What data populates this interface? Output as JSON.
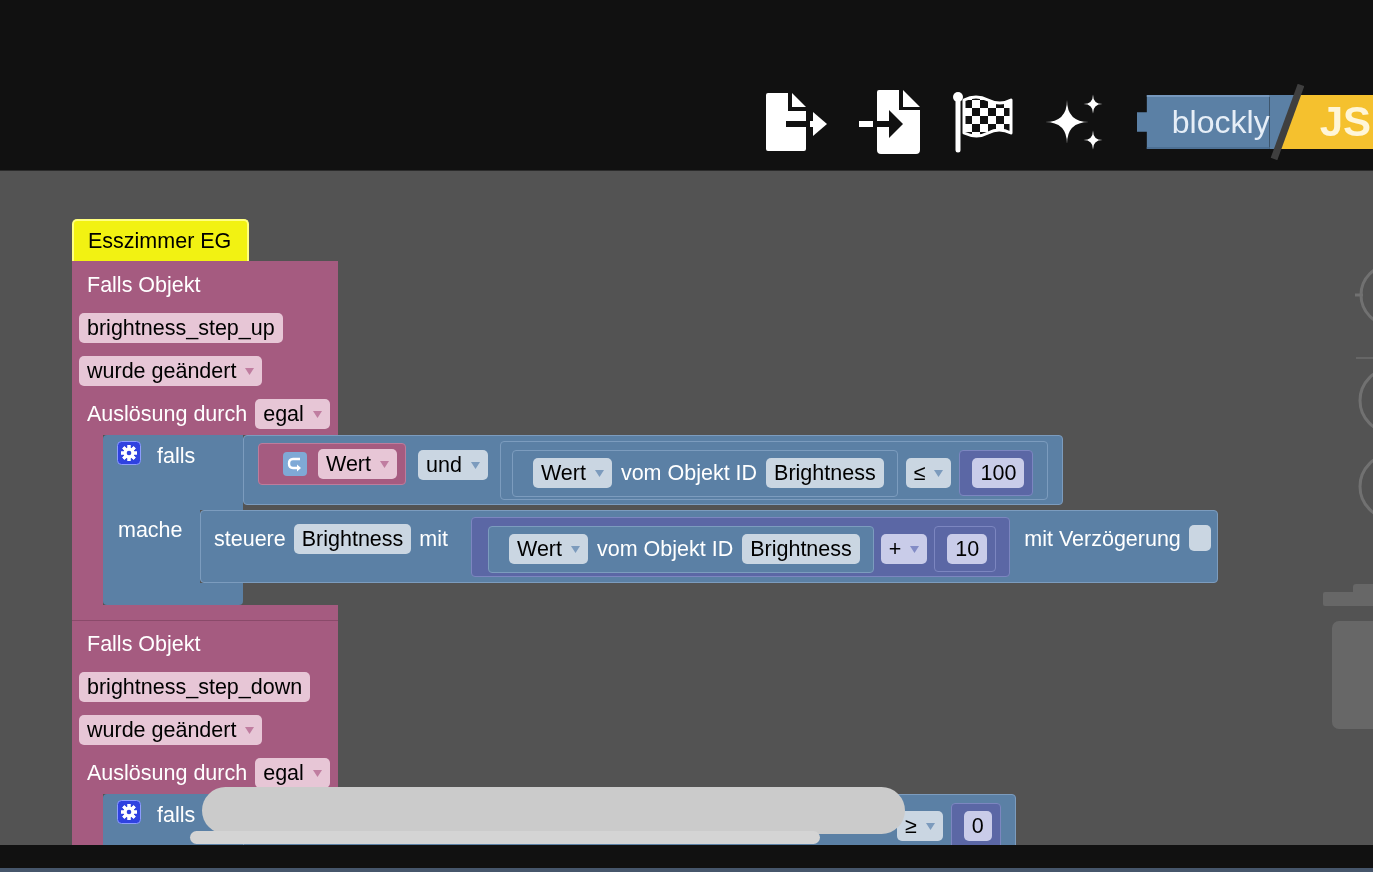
{
  "header": {
    "logo": {
      "name": "blockly",
      "suffix": "JS"
    }
  },
  "workspace": {
    "scripts": [
      {
        "title": "Esszimmer EG",
        "events": [
          {
            "label": "Falls Objekt",
            "object": "brightness_step_up",
            "event": "wurde geändert",
            "trigger_label": "Auslösung durch",
            "trigger": "egal",
            "statements": [
              {
                "kind": "if",
                "label": "falls",
                "action_label": "mache",
                "condition": {
                  "kind": "logic",
                  "op": "und",
                  "left": {
                    "kind": "trigger_value",
                    "field": "Wert"
                  },
                  "right": {
                    "kind": "compare",
                    "op": "≤",
                    "left": {
                      "kind": "object_value",
                      "field": "Wert",
                      "label": "vom Objekt ID",
                      "object": "Brightness"
                    },
                    "right": {
                      "kind": "number",
                      "value": "100"
                    }
                  }
                },
                "actions": [
                  {
                    "kind": "control",
                    "label": "steuere",
                    "object": "Brightness",
                    "with_label": "mit",
                    "value": {
                      "kind": "arithmetic",
                      "op": "+",
                      "left": {
                        "kind": "object_value",
                        "field": "Wert",
                        "label": "vom Objekt ID",
                        "object": "Brightness"
                      },
                      "right": {
                        "kind": "number",
                        "value": "10"
                      }
                    },
                    "delay_label": "mit Verzögerung",
                    "delay": false
                  }
                ]
              }
            ]
          },
          {
            "label": "Falls Objekt",
            "object": "brightness_step_down",
            "event": "wurde geändert",
            "trigger_label": "Auslösung durch",
            "trigger": "egal",
            "statements": [
              {
                "kind": "if",
                "label": "falls",
                "redacted": true,
                "condition": {
                  "kind": "compare",
                  "op": "≥",
                  "right": {
                    "kind": "number",
                    "value": "0"
                  }
                }
              }
            ]
          }
        ]
      }
    ]
  }
}
